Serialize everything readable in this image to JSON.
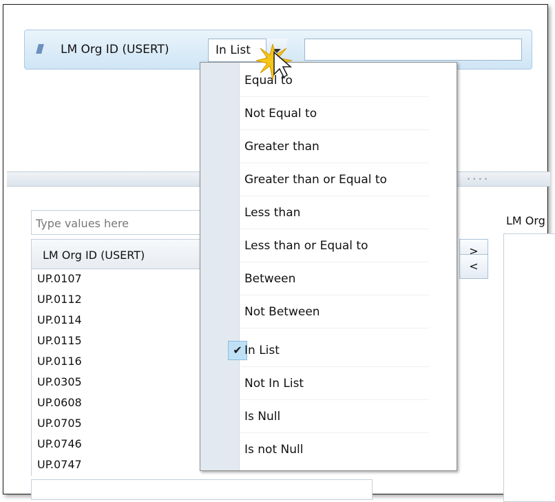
{
  "filter": {
    "field_label": "LM Org ID (USERT)",
    "operator_value": "In List",
    "value_text": ""
  },
  "list": {
    "search_placeholder": "Type values here",
    "header": "LM Org ID (USERT)",
    "items": [
      "UP.0107",
      "UP.0112",
      "UP.0114",
      "UP.0115",
      "UP.0116",
      "UP.0305",
      "UP.0608",
      "UP.0705",
      "UP.0746",
      "UP.0747"
    ]
  },
  "buttons": {
    "add": ">",
    "remove": "<"
  },
  "right_panel": {
    "label": "LM Org"
  },
  "operator_menu": {
    "items": [
      "Equal to",
      "Not Equal to",
      "Greater than",
      "Greater than or Equal to",
      "Less than",
      "Less than or Equal to",
      "Between",
      "Not Between",
      "In List",
      "Not In List",
      "Is Null",
      "Is not Null"
    ],
    "selected_index": 8
  },
  "colors": {
    "bar_bg": "#cfe5f5",
    "menu_gutter": "#e2e9f0",
    "selected_highlight": "#bfe0f5"
  }
}
